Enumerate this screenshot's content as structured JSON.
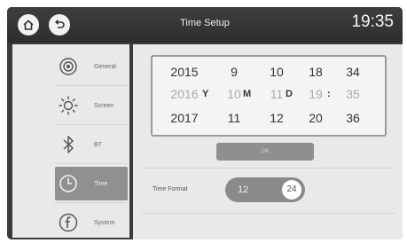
{
  "header": {
    "title": "Time Setup",
    "clock": "19:35"
  },
  "sidebar": {
    "items": [
      {
        "label": "General",
        "icon": "gear-icon"
      },
      {
        "label": "Screen",
        "icon": "brightness-icon"
      },
      {
        "label": "BT",
        "icon": "bluetooth-icon"
      },
      {
        "label": "Time",
        "icon": "clock-icon",
        "active": true
      },
      {
        "label": "System",
        "icon": "info-icon"
      }
    ]
  },
  "picker": {
    "prev": [
      "2015",
      "9",
      "10",
      "18",
      "34"
    ],
    "current": [
      "2016",
      "10",
      "11",
      "19",
      "35"
    ],
    "next": [
      "2017",
      "11",
      "12",
      "20",
      "36"
    ],
    "units": {
      "year": "Y",
      "month": "M",
      "day": "D",
      "separator": ":"
    }
  },
  "ok_button": "OK",
  "time_format": {
    "label": "Time Format",
    "option_12": "12",
    "option_24": "24",
    "selected": "24"
  },
  "colors": {
    "frame": "#3a3a3a",
    "panel": "#e9e9e9",
    "active_item": "#909090",
    "toggle": "#8a8a8a"
  }
}
